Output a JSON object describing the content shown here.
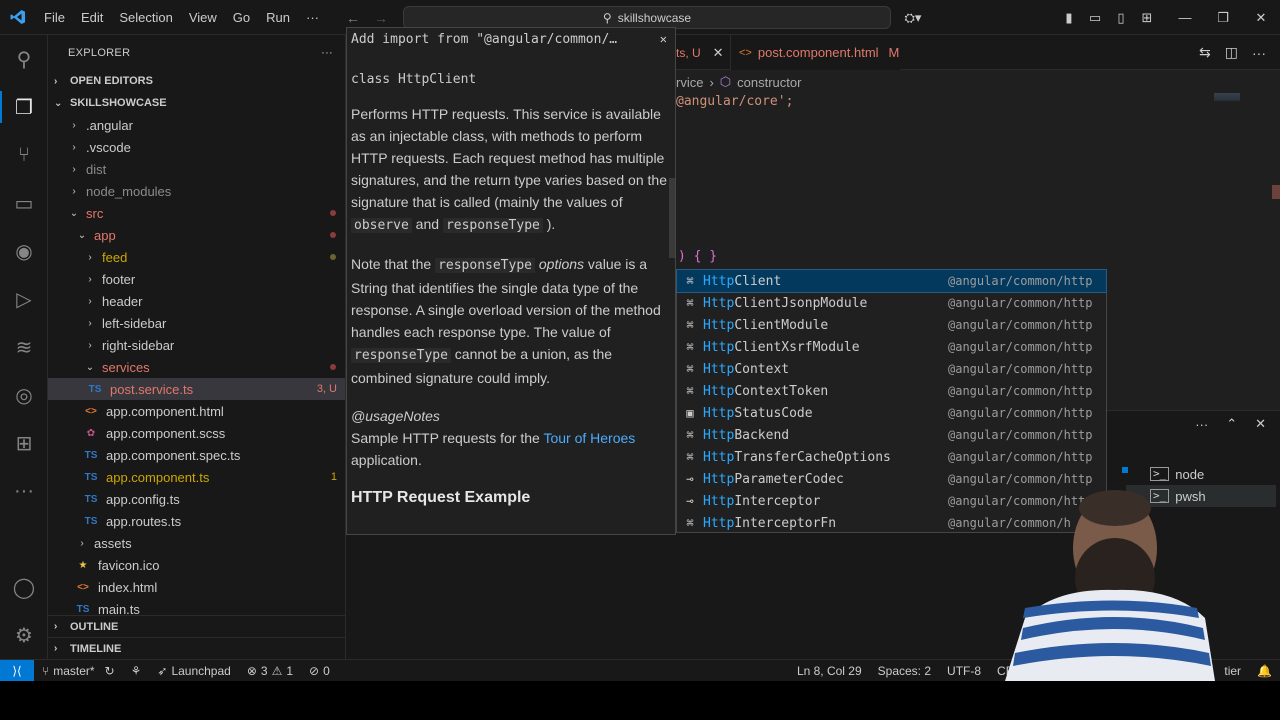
{
  "titlebar": {
    "menu": [
      "File",
      "Edit",
      "Selection",
      "View",
      "Go",
      "Run"
    ],
    "more": "···",
    "search": "skillshowcase"
  },
  "explorer": {
    "title": "EXPLORER",
    "open_editors": "OPEN EDITORS",
    "root": "SKILLSHOWCASE",
    "tree": [
      {
        "label": ".angular",
        "depth": 1,
        "chev": "›",
        "cls": "c-plain"
      },
      {
        "label": ".vscode",
        "depth": 1,
        "chev": "›",
        "cls": "c-plain"
      },
      {
        "label": "dist",
        "depth": 1,
        "chev": "›",
        "cls": "c-gray"
      },
      {
        "label": "node_modules",
        "depth": 1,
        "chev": "›",
        "cls": "c-gray"
      },
      {
        "label": "src",
        "depth": 1,
        "chev": "⌄",
        "cls": "c-red",
        "dot": true
      },
      {
        "label": "app",
        "depth": 2,
        "chev": "⌄",
        "cls": "c-red",
        "dot": true
      },
      {
        "label": "feed",
        "depth": 3,
        "chev": "›",
        "cls": "c-yellow",
        "dot": "yellow"
      },
      {
        "label": "footer",
        "depth": 3,
        "chev": "›",
        "cls": "c-plain"
      },
      {
        "label": "header",
        "depth": 3,
        "chev": "›",
        "cls": "c-plain"
      },
      {
        "label": "left-sidebar",
        "depth": 3,
        "chev": "›",
        "cls": "c-plain"
      },
      {
        "label": "right-sidebar",
        "depth": 3,
        "chev": "›",
        "cls": "c-plain"
      },
      {
        "label": "services",
        "depth": 3,
        "chev": "⌄",
        "cls": "c-red",
        "dot": true
      },
      {
        "label": "post.service.ts",
        "depth": 4,
        "icon": "TS",
        "icls": "c-ts",
        "cls": "c-red",
        "badge": "3, U",
        "selected": true
      },
      {
        "label": "app.component.html",
        "depth": 3,
        "icon": "<>",
        "icls": "c-html",
        "cls": "c-plain"
      },
      {
        "label": "app.component.scss",
        "depth": 3,
        "icon": "✿",
        "icls": "c-scss",
        "cls": "c-plain"
      },
      {
        "label": "app.component.spec.ts",
        "depth": 3,
        "icon": "TS",
        "icls": "c-ts",
        "cls": "c-plain"
      },
      {
        "label": "app.component.ts",
        "depth": 3,
        "icon": "TS",
        "icls": "c-ts",
        "cls": "c-yellow",
        "badge": "1",
        "badgecls": "c-yellow"
      },
      {
        "label": "app.config.ts",
        "depth": 3,
        "icon": "TS",
        "icls": "c-ts",
        "cls": "c-plain"
      },
      {
        "label": "app.routes.ts",
        "depth": 3,
        "icon": "TS",
        "icls": "c-ts",
        "cls": "c-plain"
      },
      {
        "label": "assets",
        "depth": 2,
        "chev": "›",
        "cls": "c-plain"
      },
      {
        "label": "favicon.ico",
        "depth": 2,
        "icon": "★",
        "icls": "c-star",
        "cls": "c-plain"
      },
      {
        "label": "index.html",
        "depth": 2,
        "icon": "<>",
        "icls": "c-html",
        "cls": "c-plain"
      },
      {
        "label": "main.ts",
        "depth": 2,
        "icon": "TS",
        "icls": "c-ts",
        "cls": "c-plain"
      }
    ],
    "outline": "OUTLINE",
    "timeline": "TIMELINE"
  },
  "editor": {
    "tab_fragment": "ts, U",
    "tab_active": "post.component.html",
    "tab_active_flag": "M",
    "breadcrumb_part": "rvice",
    "breadcrumb_symbol": "constructor",
    "code_import": "@angular/core';",
    "code_body": ") { }"
  },
  "hover": {
    "status": "Add import from \"@angular/common/…",
    "signature": "class HttpClient",
    "p1_a": "Performs HTTP requests. This service is available as an injectable class, with methods to perform HTTP requests. Each request method has multiple signatures, and the return type varies based on the signature that is called (mainly the values of ",
    "p1_code1": "observe",
    "p1_b": " and ",
    "p1_code2": "responseType",
    "p1_c": " ).",
    "p2_a": "Note that the ",
    "p2_code1": "responseType",
    "p2_em": "options",
    "p2_b": " value is a String that identifies the single data type of the response. A single overload version of the method handles each response type. The value of ",
    "p2_code2": "responseType",
    "p2_c": " cannot be a union, as the combined signature could imply.",
    "usage": "@usageNotes",
    "usage_a": "Sample HTTP requests for the ",
    "usage_link": "Tour of Heroes",
    "usage_b": " application.",
    "heading": "HTTP Request Example"
  },
  "suggest": {
    "items": [
      {
        "match": "Http",
        "rest": "Client",
        "detail": "@angular/common/http",
        "icon": "⌘"
      },
      {
        "match": "Http",
        "rest": "ClientJsonpModule",
        "detail": "@angular/common/http",
        "icon": "⌘"
      },
      {
        "match": "Http",
        "rest": "ClientModule",
        "detail": "@angular/common/http",
        "icon": "⌘"
      },
      {
        "match": "Http",
        "rest": "ClientXsrfModule",
        "detail": "@angular/common/http",
        "icon": "⌘"
      },
      {
        "match": "Http",
        "rest": "Context",
        "detail": "@angular/common/http",
        "icon": "⌘"
      },
      {
        "match": "Http",
        "rest": "ContextToken",
        "detail": "@angular/common/http",
        "icon": "⌘"
      },
      {
        "match": "Http",
        "rest": "StatusCode",
        "detail": "@angular/common/http",
        "icon": "▣"
      },
      {
        "match": "Http",
        "rest": "Backend",
        "detail": "@angular/common/http",
        "icon": "⌘"
      },
      {
        "match": "Http",
        "rest": "TransferCacheOptions",
        "detail": "@angular/common/http",
        "icon": "⌘"
      },
      {
        "match": "Http",
        "rest": "ParameterCodec",
        "detail": "@angular/common/http",
        "icon": "⊸"
      },
      {
        "match": "Http",
        "rest": "Interceptor",
        "detail": "@angular/common/htt",
        "icon": "⊸"
      },
      {
        "match": "Http",
        "rest": "InterceptorFn",
        "detail": "@angular/common/h",
        "icon": "⌘"
      }
    ]
  },
  "terminal": {
    "items": [
      "node",
      "pwsh"
    ]
  },
  "statusbar": {
    "branch": "master*",
    "launchpad": "Launchpad",
    "errors": "3",
    "warnings": "1",
    "ports": "0",
    "position": "Ln 8, Col 29",
    "spaces": "Spaces: 2",
    "encoding": "UTF-8",
    "eol": "CRLF",
    "extra": "tier"
  },
  "colors": {
    "accent": "#0078d4",
    "match": "#2aaaff",
    "modified": "#e2786b",
    "warning": "#cca700"
  }
}
